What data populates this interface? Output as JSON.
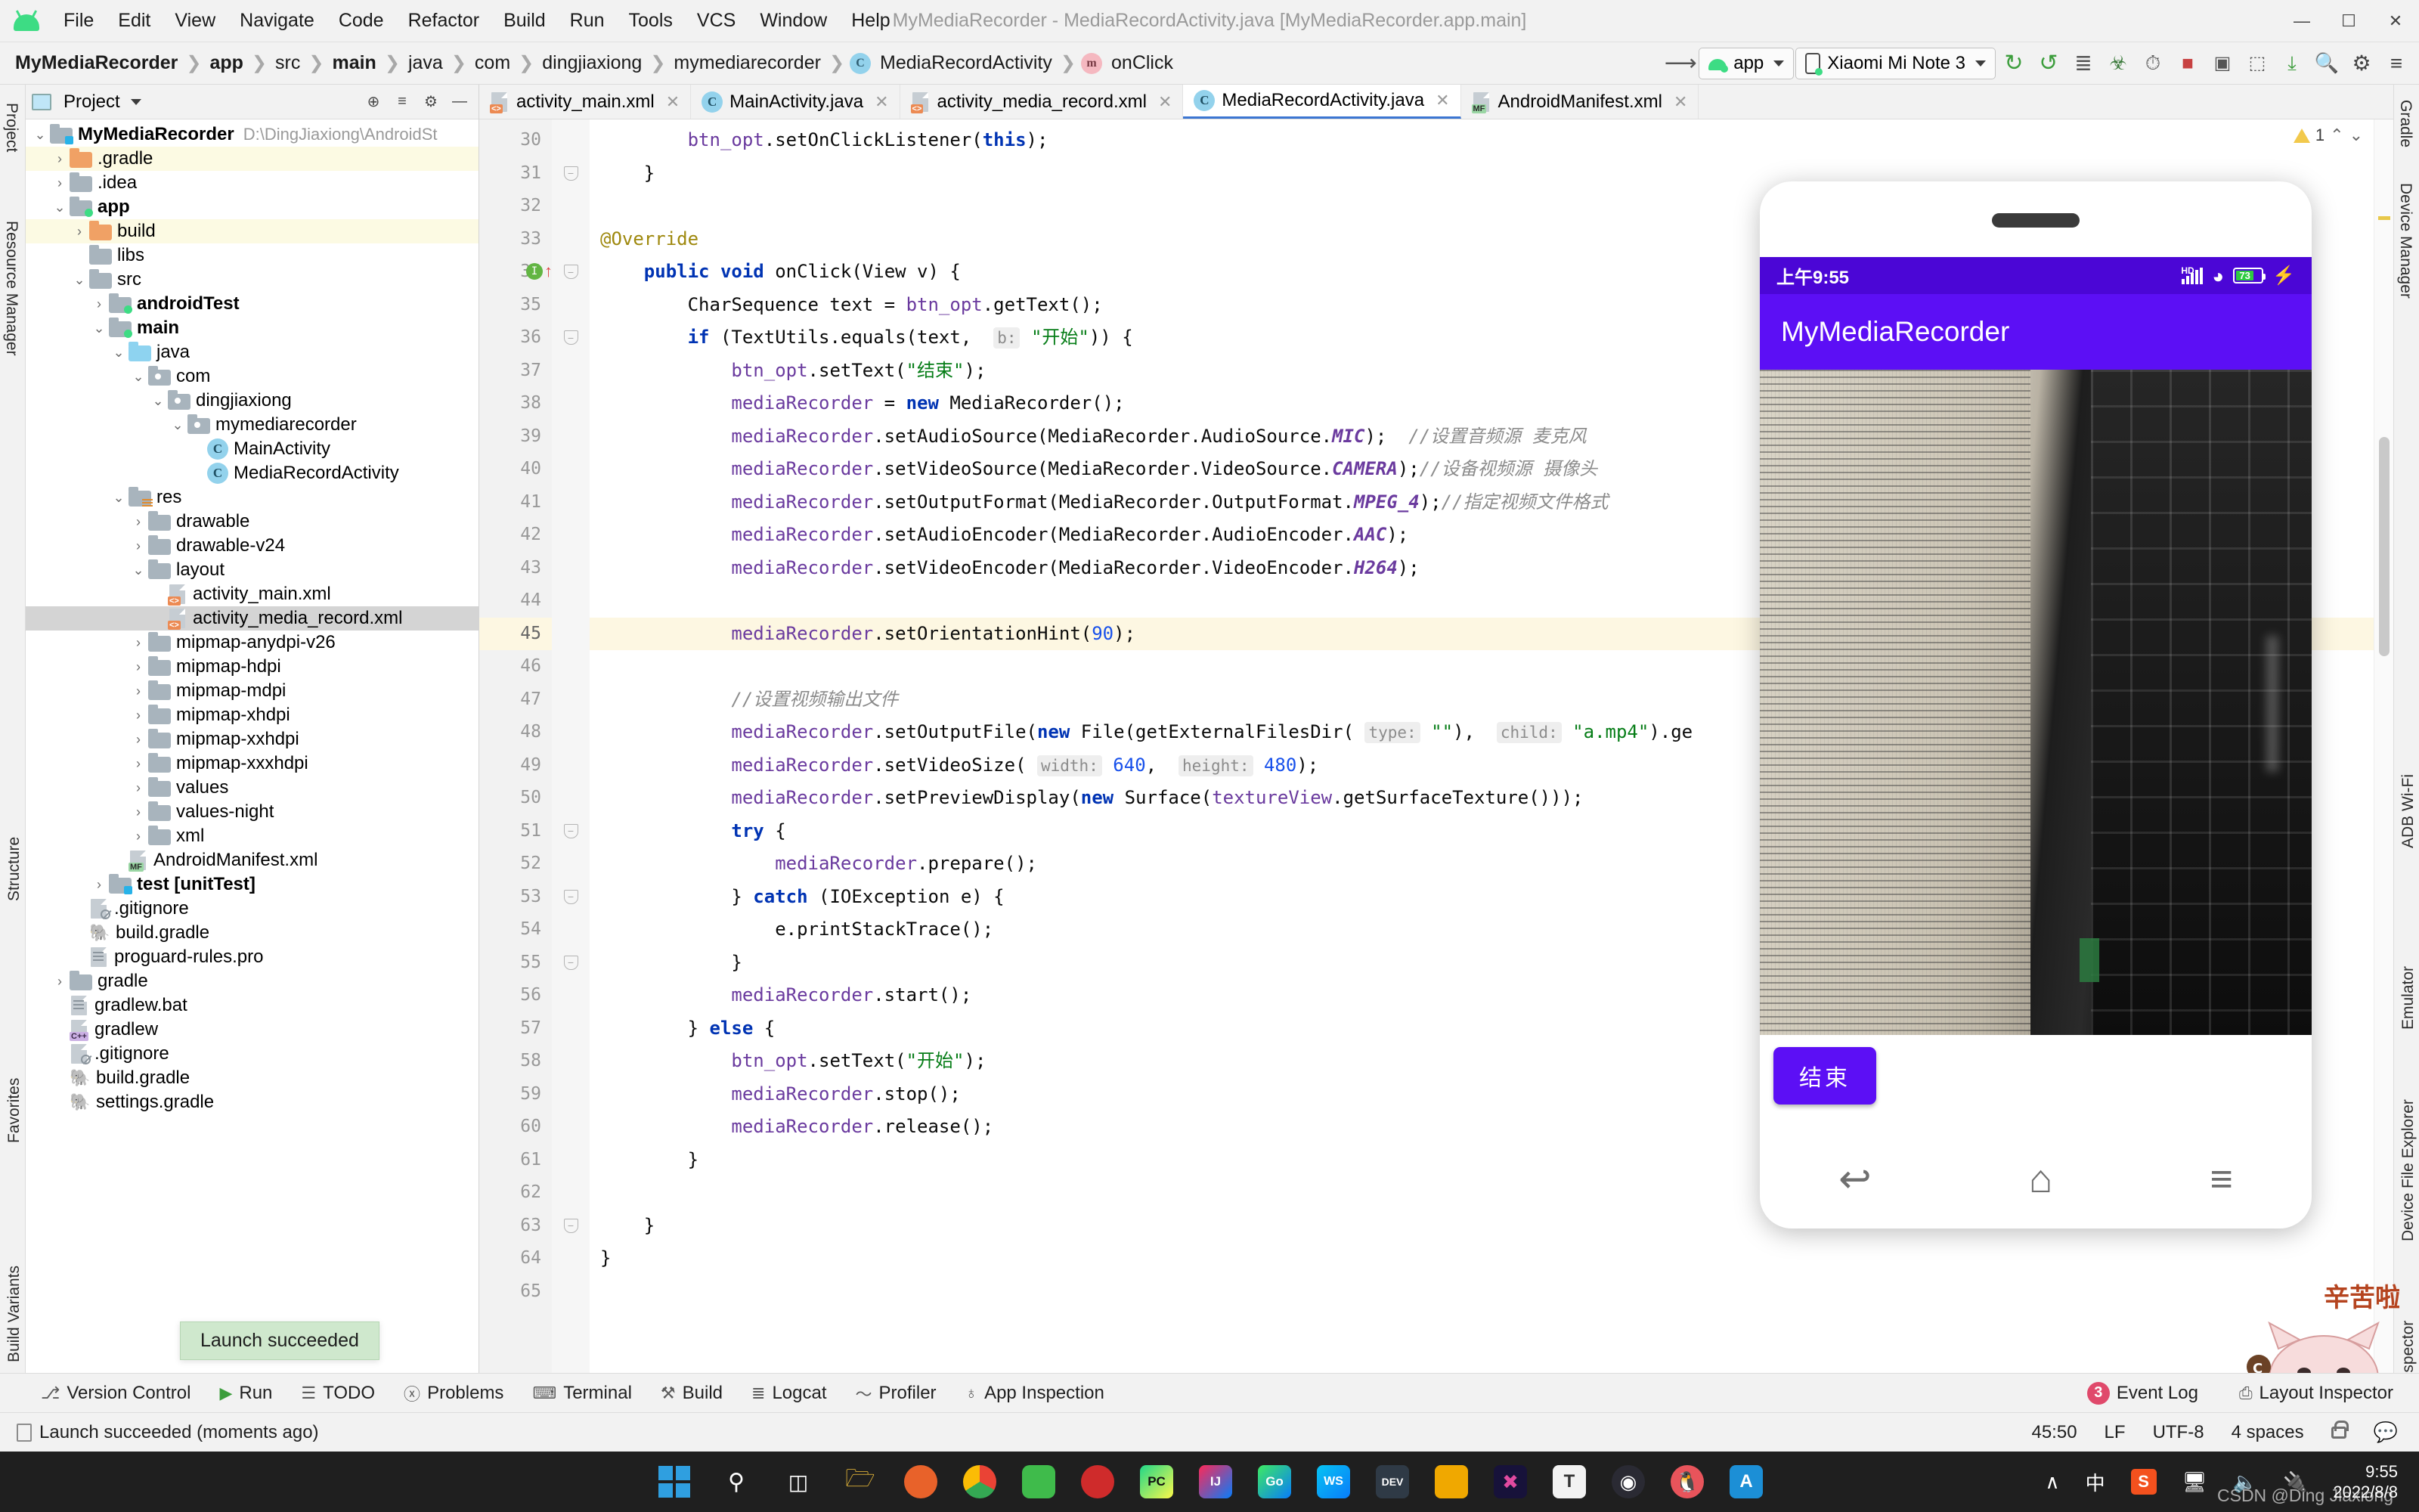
{
  "window": {
    "title": "MyMediaRecorder - MediaRecordActivity.java [MyMediaRecorder.app.main]",
    "minimize": "—",
    "maximize": "☐",
    "close": "✕"
  },
  "menubar": [
    {
      "label": "File"
    },
    {
      "label": "Edit"
    },
    {
      "label": "View"
    },
    {
      "label": "Navigate"
    },
    {
      "label": "Code"
    },
    {
      "label": "Refactor"
    },
    {
      "label": "Build"
    },
    {
      "label": "Run"
    },
    {
      "label": "Tools"
    },
    {
      "label": "VCS"
    },
    {
      "label": "Window"
    },
    {
      "label": "Help"
    }
  ],
  "breadcrumbs": [
    {
      "label": "MyMediaRecorder",
      "bold": true
    },
    {
      "label": "app",
      "bold": true
    },
    {
      "label": "src",
      "bold": false
    },
    {
      "label": "main",
      "bold": true
    },
    {
      "label": "java",
      "bold": false
    },
    {
      "label": "com",
      "bold": false
    },
    {
      "label": "dingjiaxiong",
      "bold": false
    },
    {
      "label": "mymediarecorder",
      "bold": false
    },
    {
      "label": "MediaRecordActivity",
      "bold": false,
      "icon": "class-icon",
      "icon_letter": "C"
    },
    {
      "label": "onClick",
      "bold": false,
      "icon": "method-icon",
      "icon_letter": "m"
    }
  ],
  "toolbar": {
    "run_config": "app",
    "device": "Xiaomi Mi Note 3",
    "buttons": [
      {
        "name": "back-arrow-icon",
        "glyph": "↖"
      },
      {
        "name": "run-icon",
        "glyph": "↻"
      },
      {
        "name": "run-with-coverage-icon",
        "glyph": "↻"
      },
      {
        "name": "apply-changes-icon",
        "glyph": "≣"
      },
      {
        "name": "debug-icon",
        "glyph": "🐞"
      },
      {
        "name": "profile-icon",
        "glyph": "⏱"
      },
      {
        "name": "stop-icon",
        "glyph": "■"
      },
      {
        "name": "avd-manager-icon",
        "glyph": "▣"
      },
      {
        "name": "sdk-manager-icon",
        "glyph": "⬚"
      },
      {
        "name": "sync-gradle-icon",
        "glyph": "⤓"
      },
      {
        "name": "search-icon",
        "glyph": "🔍"
      },
      {
        "name": "settings-gear-icon",
        "glyph": "⚙"
      },
      {
        "name": "menu-icon",
        "glyph": "≡"
      }
    ]
  },
  "left_rail": [
    "Project",
    "Resource Manager",
    "Structure",
    "Favorites",
    "Build Variants"
  ],
  "right_rail": [
    "Gradle",
    "Device Manager",
    "ADB Wi-Fi",
    "Emulator",
    "Device File Explorer",
    "Layout Inspector"
  ],
  "project_panel": {
    "title": "Project",
    "header_icons": [
      {
        "name": "collapse-all-icon",
        "glyph": "⊕"
      },
      {
        "name": "expand-icon",
        "glyph": "≡"
      },
      {
        "name": "settings-icon",
        "glyph": "⚙"
      },
      {
        "name": "hide-icon",
        "glyph": "—"
      }
    ],
    "tree": [
      {
        "indent": 0,
        "arrow": "v",
        "label": "MyMediaRecorder",
        "bold": true,
        "icon": "module-folder",
        "path": "D:\\DingJiaxiong\\AndroidSt",
        "state": ""
      },
      {
        "indent": 1,
        "arrow": ">",
        "label": ".gradle",
        "bold": false,
        "icon": "folder-orange",
        "state": "hl-yellow"
      },
      {
        "indent": 1,
        "arrow": ">",
        "label": ".idea",
        "bold": false,
        "icon": "folder",
        "state": ""
      },
      {
        "indent": 1,
        "arrow": "v",
        "label": "app",
        "bold": true,
        "icon": "module-folder-green",
        "state": ""
      },
      {
        "indent": 2,
        "arrow": ">",
        "label": "build",
        "bold": false,
        "icon": "folder-orange",
        "state": "hl-yellow"
      },
      {
        "indent": 2,
        "arrow": "",
        "label": "libs",
        "bold": false,
        "icon": "folder",
        "state": ""
      },
      {
        "indent": 2,
        "arrow": "v",
        "label": "src",
        "bold": false,
        "icon": "folder",
        "state": ""
      },
      {
        "indent": 3,
        "arrow": ">",
        "label": "androidTest",
        "bold": true,
        "icon": "module-folder-green",
        "state": ""
      },
      {
        "indent": 3,
        "arrow": "v",
        "label": "main",
        "bold": true,
        "icon": "module-folder-green",
        "state": ""
      },
      {
        "indent": 4,
        "arrow": "v",
        "label": "java",
        "bold": false,
        "icon": "folder-blue",
        "state": ""
      },
      {
        "indent": 5,
        "arrow": "v",
        "label": "com",
        "bold": false,
        "icon": "package",
        "state": ""
      },
      {
        "indent": 6,
        "arrow": "v",
        "label": "dingjiaxiong",
        "bold": false,
        "icon": "package",
        "state": ""
      },
      {
        "indent": 7,
        "arrow": "v",
        "label": "mymediarecorder",
        "bold": false,
        "icon": "package",
        "state": ""
      },
      {
        "indent": 8,
        "arrow": "",
        "label": "MainActivity",
        "bold": false,
        "icon": "class",
        "state": ""
      },
      {
        "indent": 8,
        "arrow": "",
        "label": "MediaRecordActivity",
        "bold": false,
        "icon": "class",
        "state": ""
      },
      {
        "indent": 4,
        "arrow": "v",
        "label": "res",
        "bold": false,
        "icon": "res-folder",
        "state": ""
      },
      {
        "indent": 5,
        "arrow": ">",
        "label": "drawable",
        "bold": false,
        "icon": "folder",
        "state": ""
      },
      {
        "indent": 5,
        "arrow": ">",
        "label": "drawable-v24",
        "bold": false,
        "icon": "folder",
        "state": ""
      },
      {
        "indent": 5,
        "arrow": "v",
        "label": "layout",
        "bold": false,
        "icon": "folder",
        "state": ""
      },
      {
        "indent": 6,
        "arrow": "",
        "label": "activity_main.xml",
        "bold": false,
        "icon": "xml-file",
        "state": ""
      },
      {
        "indent": 6,
        "arrow": "",
        "label": "activity_media_record.xml",
        "bold": false,
        "icon": "xml-file",
        "state": "selected"
      },
      {
        "indent": 5,
        "arrow": ">",
        "label": "mipmap-anydpi-v26",
        "bold": false,
        "icon": "folder",
        "state": ""
      },
      {
        "indent": 5,
        "arrow": ">",
        "label": "mipmap-hdpi",
        "bold": false,
        "icon": "folder",
        "state": ""
      },
      {
        "indent": 5,
        "arrow": ">",
        "label": "mipmap-mdpi",
        "bold": false,
        "icon": "folder",
        "state": ""
      },
      {
        "indent": 5,
        "arrow": ">",
        "label": "mipmap-xhdpi",
        "bold": false,
        "icon": "folder",
        "state": ""
      },
      {
        "indent": 5,
        "arrow": ">",
        "label": "mipmap-xxhdpi",
        "bold": false,
        "icon": "folder",
        "state": ""
      },
      {
        "indent": 5,
        "arrow": ">",
        "label": "mipmap-xxxhdpi",
        "bold": false,
        "icon": "folder",
        "state": ""
      },
      {
        "indent": 5,
        "arrow": ">",
        "label": "values",
        "bold": false,
        "icon": "folder",
        "state": ""
      },
      {
        "indent": 5,
        "arrow": ">",
        "label": "values-night",
        "bold": false,
        "icon": "folder",
        "state": ""
      },
      {
        "indent": 5,
        "arrow": ">",
        "label": "xml",
        "bold": false,
        "icon": "folder",
        "state": ""
      },
      {
        "indent": 4,
        "arrow": "",
        "label": "AndroidManifest.xml",
        "bold": false,
        "icon": "mf-file",
        "state": ""
      },
      {
        "indent": 3,
        "arrow": ">",
        "label": "test [unitTest]",
        "bold": true,
        "icon": "module-folder-cyan",
        "state": ""
      },
      {
        "indent": 2,
        "arrow": "",
        "label": ".gitignore",
        "bold": false,
        "icon": "ignore-file",
        "state": ""
      },
      {
        "indent": 2,
        "arrow": "",
        "label": "build.gradle",
        "bold": false,
        "icon": "gradle-file",
        "state": ""
      },
      {
        "indent": 2,
        "arrow": "",
        "label": "proguard-rules.pro",
        "bold": false,
        "icon": "text-file",
        "state": ""
      },
      {
        "indent": 1,
        "arrow": ">",
        "label": "gradle",
        "bold": false,
        "icon": "folder",
        "state": ""
      },
      {
        "indent": 1,
        "arrow": "",
        "label": "gradlew.bat",
        "bold": false,
        "icon": "text-file",
        "state": ""
      },
      {
        "indent": 1,
        "arrow": "",
        "label": "gradlew",
        "bold": false,
        "icon": "cpp-file",
        "state": ""
      },
      {
        "indent": 1,
        "arrow": "",
        "label": ".gitignore",
        "bold": false,
        "icon": "ignore-file",
        "state": ""
      },
      {
        "indent": 1,
        "arrow": "",
        "label": "build.gradle",
        "bold": false,
        "icon": "gradle-file",
        "state": ""
      },
      {
        "indent": 1,
        "arrow": "",
        "label": "settings.gradle",
        "bold": false,
        "icon": "gradle-file",
        "state": ""
      }
    ]
  },
  "editor": {
    "tabs": [
      {
        "label": "activity_main.xml",
        "icon": "xml-file",
        "active": false
      },
      {
        "label": "MainActivity.java",
        "icon": "class",
        "active": false
      },
      {
        "label": "activity_media_record.xml",
        "icon": "xml-file",
        "active": false
      },
      {
        "label": "MediaRecordActivity.java",
        "icon": "class",
        "active": true
      },
      {
        "label": "AndroidManifest.xml",
        "icon": "mf-file",
        "active": false
      }
    ],
    "inspection_count": "1",
    "first_line_number": 30,
    "current_line": 45,
    "lines": [
      {
        "n": 30,
        "text": "        btn_opt.setOnClickListener(this);"
      },
      {
        "n": 31,
        "text": "    }"
      },
      {
        "n": 32,
        "text": ""
      },
      {
        "n": 33,
        "text": "    @Override"
      },
      {
        "n": 34,
        "text": "    public void onClick(View v) {"
      },
      {
        "n": 35,
        "text": "        CharSequence text = btn_opt.getText();"
      },
      {
        "n": 36,
        "text": "        if (TextUtils.equals(text,  b: \"开始\")) {"
      },
      {
        "n": 37,
        "text": "            btn_opt.setText(\"结束\");"
      },
      {
        "n": 38,
        "text": "            mediaRecorder = new MediaRecorder();"
      },
      {
        "n": 39,
        "text": "            mediaRecorder.setAudioSource(MediaRecorder.AudioSource.MIC);  //设置音频源 麦克风"
      },
      {
        "n": 40,
        "text": "            mediaRecorder.setVideoSource(MediaRecorder.VideoSource.CAMERA);//设备视频源 摄像头"
      },
      {
        "n": 41,
        "text": "            mediaRecorder.setOutputFormat(MediaRecorder.OutputFormat.MPEG_4);//指定视频文件格式"
      },
      {
        "n": 42,
        "text": "            mediaRecorder.setAudioEncoder(MediaRecorder.AudioEncoder.AAC);"
      },
      {
        "n": 43,
        "text": "            mediaRecorder.setVideoEncoder(MediaRecorder.VideoEncoder.H264);"
      },
      {
        "n": 44,
        "text": ""
      },
      {
        "n": 45,
        "text": "            mediaRecorder.setOrientationHint(90);"
      },
      {
        "n": 46,
        "text": ""
      },
      {
        "n": 47,
        "text": "            //设置视频输出文件"
      },
      {
        "n": 48,
        "text": "            mediaRecorder.setOutputFile(new File(getExternalFilesDir( type: \"\"),  child: \"a.mp4\").ge"
      },
      {
        "n": 49,
        "text": "            mediaRecorder.setVideoSize( width: 640,  height: 480);"
      },
      {
        "n": 50,
        "text": "            mediaRecorder.setPreviewDisplay(new Surface(textureView.getSurfaceTexture()));"
      },
      {
        "n": 51,
        "text": "            try {"
      },
      {
        "n": 52,
        "text": "                mediaRecorder.prepare();"
      },
      {
        "n": 53,
        "text": "            } catch (IOException e) {"
      },
      {
        "n": 54,
        "text": "                e.printStackTrace();"
      },
      {
        "n": 55,
        "text": "            }"
      },
      {
        "n": 56,
        "text": "            mediaRecorder.start();"
      },
      {
        "n": 57,
        "text": "        } else {"
      },
      {
        "n": 58,
        "text": "            btn_opt.setText(\"开始\");"
      },
      {
        "n": 59,
        "text": "            mediaRecorder.stop();"
      },
      {
        "n": 60,
        "text": "            mediaRecorder.release();"
      },
      {
        "n": 61,
        "text": "        }"
      },
      {
        "n": 62,
        "text": ""
      },
      {
        "n": 63,
        "text": "    }"
      },
      {
        "n": 64,
        "text": "}"
      },
      {
        "n": 65,
        "text": ""
      }
    ]
  },
  "phone": {
    "status_time": "上午9:55",
    "network_label": "HD",
    "battery_percent": "73",
    "app_title": "MyMediaRecorder",
    "button_label": "结束",
    "nav": [
      {
        "name": "back-icon",
        "glyph": "↩"
      },
      {
        "name": "home-icon",
        "glyph": "⌂"
      },
      {
        "name": "recents-icon",
        "glyph": "≡"
      }
    ]
  },
  "launch_tooltip": "Launch succeeded",
  "tool_windows": [
    {
      "label": "Version Control",
      "icon": "branch-icon",
      "glyph": "⎇"
    },
    {
      "label": "Run",
      "icon": "run-icon",
      "glyph": "▶"
    },
    {
      "label": "TODO",
      "icon": "todo-icon",
      "glyph": "☰"
    },
    {
      "label": "Problems",
      "icon": "problems-icon",
      "glyph": "ⓧ"
    },
    {
      "label": "Terminal",
      "icon": "terminal-icon",
      "glyph": "⌨"
    },
    {
      "label": "Build",
      "icon": "build-icon",
      "glyph": "⚒"
    },
    {
      "label": "Logcat",
      "icon": "logcat-icon",
      "glyph": "≣"
    },
    {
      "label": "Profiler",
      "icon": "profiler-icon",
      "glyph": "〜"
    },
    {
      "label": "App Inspection",
      "icon": "inspection-icon",
      "glyph": "♁"
    }
  ],
  "tool_windows_right": [
    {
      "label": "Event Log",
      "badge": "3",
      "icon": "event-log-icon"
    },
    {
      "label": "Layout Inspector",
      "badge": "",
      "icon": "layout-inspector-icon"
    }
  ],
  "status_bar": {
    "message": "Launch succeeded (moments ago)",
    "caret": "45:50",
    "line_sep": "LF",
    "encoding": "UTF-8",
    "indent": "4 spaces",
    "lock_icon": "unlocked-icon",
    "notify_icon": "notification-icon"
  },
  "taskbar": {
    "items": [
      {
        "name": "start-button",
        "glyph": ""
      },
      {
        "name": "search-icon",
        "glyph": "⌕"
      },
      {
        "name": "task-view-icon",
        "glyph": "▭"
      },
      {
        "name": "file-explorer-icon",
        "glyph": "📁"
      },
      {
        "name": "firefox-icon",
        "glyph": "●"
      },
      {
        "name": "chrome-icon",
        "glyph": "●"
      },
      {
        "name": "wechat-icon",
        "glyph": "●"
      },
      {
        "name": "netease-music-icon",
        "glyph": "●"
      },
      {
        "name": "pycharm-icon",
        "glyph": "PC"
      },
      {
        "name": "idea-icon",
        "glyph": "IJ"
      },
      {
        "name": "goland-icon",
        "glyph": "Go"
      },
      {
        "name": "webstorm-icon",
        "glyph": "WS"
      },
      {
        "name": "devtool-icon",
        "glyph": "DEV"
      },
      {
        "name": "editor-icon",
        "glyph": "■"
      },
      {
        "name": "xmind-icon",
        "glyph": "✖"
      },
      {
        "name": "typora-icon",
        "glyph": "T"
      },
      {
        "name": "obs-icon",
        "glyph": "◉"
      },
      {
        "name": "qq-icon",
        "glyph": "🐧"
      },
      {
        "name": "android-studio-icon",
        "glyph": "A"
      }
    ],
    "tray": [
      {
        "name": "show-hidden-icons",
        "glyph": "∧"
      },
      {
        "name": "ime-chinese-icon",
        "glyph": "中"
      },
      {
        "name": "sogou-input-icon",
        "glyph": "S"
      },
      {
        "name": "network-icon",
        "glyph": "🖥"
      },
      {
        "name": "volume-icon",
        "glyph": "🔊"
      },
      {
        "name": "battery-icon",
        "glyph": "🔌"
      }
    ],
    "clock_time": "9:55",
    "clock_date": "2022/8/8"
  },
  "watermark": "CSDN @Ding Jiaxiong"
}
